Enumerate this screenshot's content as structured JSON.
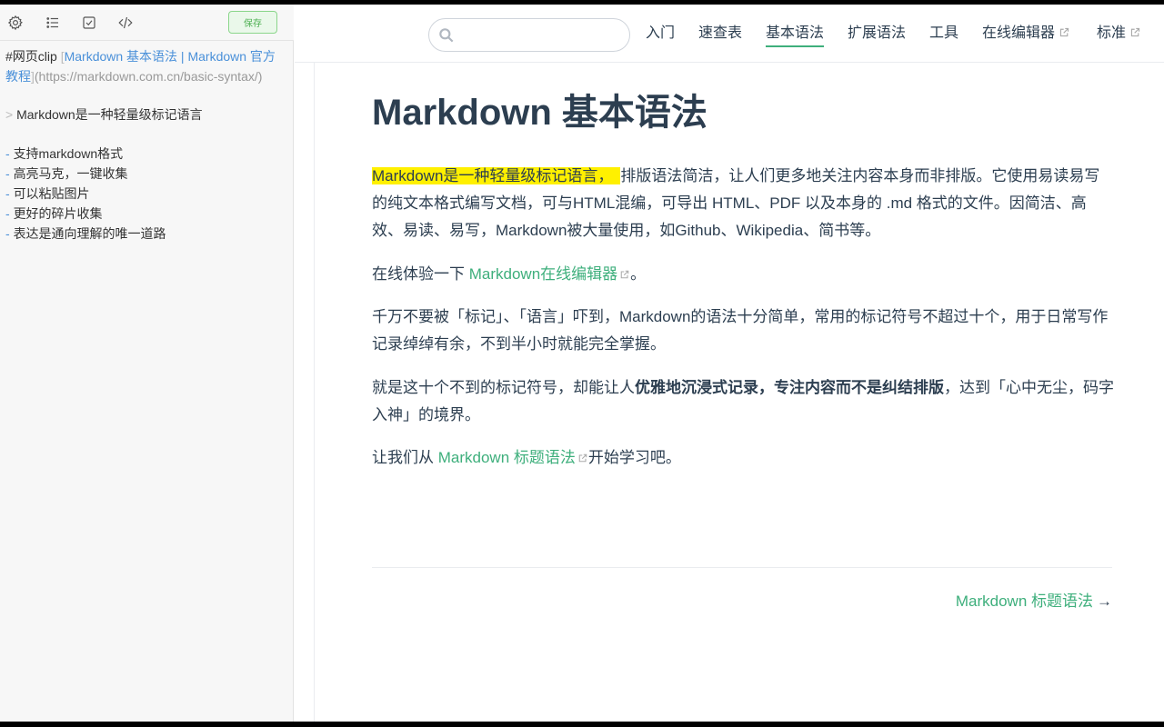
{
  "toolbar": {
    "save_label": "保存",
    "icons": [
      "gear-icon",
      "list-icon",
      "checkbox-icon",
      "code-icon"
    ]
  },
  "clip": {
    "tag": "#网页clip",
    "bracket_open": "[",
    "link_text_1": "Markdown 基本语法 | Markdown 官方",
    "link_text_2": "教程",
    "bracket_close": "]",
    "url": "(https://markdown.com.cn/basic-syntax/)",
    "quote_mark": ">",
    "quote_text": "Markdown是一种轻量级标记语言",
    "list_marker": "-",
    "list_items": [
      "支持markdown格式",
      "高亮马克，一键收集",
      "可以粘贴图片",
      "更好的碎片收集",
      "表达是通向理解的唯一道路"
    ]
  },
  "header": {
    "search_placeholder": "",
    "nav": [
      {
        "label": "入门"
      },
      {
        "label": "速查表"
      },
      {
        "label": "基本语法"
      },
      {
        "label": "扩展语法"
      },
      {
        "label": "工具"
      },
      {
        "label": "在线编辑器"
      },
      {
        "label": "标准"
      }
    ],
    "active_nav": "基本语法"
  },
  "main": {
    "title": "Markdown 基本语法",
    "p1_highlight": "Markdown是一种轻量级标记语言，",
    "p1_rest": "排版语法简洁，让人们更多地关注内容本身而非排版。它使用易读易写的纯文本格式编写文档，可与HTML混编，可导出 HTML、PDF 以及本身的 .md 格式的文件。因简洁、高效、易读、易写，Markdown被大量使用，如Github、Wikipedia、简书等。",
    "p2_before": "在线体验一下 ",
    "p2_link": "Markdown在线编辑器",
    "p2_after": "。",
    "p3": "千万不要被「标记」、「语言」吓到，Markdown的语法十分简单，常用的标记符号不超过十个，用于日常写作记录绰绰有余，不到半小时就能完全掌握。",
    "p4_before": "就是这十个不到的标记符号，却能让人",
    "p4_bold": "优雅地沉浸式记录，专注内容而不是纠结排版",
    "p4_after": "，达到「心中无尘，码字入神」的境界。",
    "p5_before": "让我们从 ",
    "p5_link": "Markdown 标题语法",
    "p5_after": "开始学习吧。",
    "next_label": "Markdown 标题语法",
    "next_arrow": "→"
  },
  "colors": {
    "accent": "#3eaf7c",
    "highlight": "#fff000",
    "text": "#2c3e50",
    "clip_link": "#4a90d9"
  }
}
